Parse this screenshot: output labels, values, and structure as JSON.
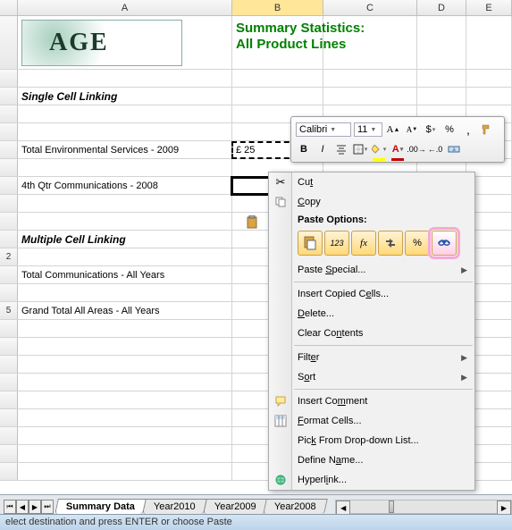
{
  "columns": [
    "A",
    "B",
    "C",
    "D",
    "E"
  ],
  "row_numbers": [
    "",
    "",
    "",
    "",
    "",
    "",
    "",
    "",
    "",
    "",
    "",
    "2",
    "",
    "",
    "5",
    "",
    "",
    "",
    "",
    "",
    "",
    "",
    "",
    "",
    "",
    "",
    ""
  ],
  "title1": "Summary Statistics:",
  "title2": "All Product Lines",
  "logo_text": "AGE",
  "section1": "Single Cell Linking",
  "r6_a": "Total Environmental Services - 2009",
  "r6_b": "£    25",
  "r8_a": "4th Qtr Communications - 2008",
  "section2": "Multiple Cell Linking",
  "r13_a": "Total Communications - All Years",
  "r15_a": "Grand Total All Areas - All Years",
  "mini": {
    "font": "Calibri",
    "size": "11",
    "percent": "%",
    "comma": ","
  },
  "context_menu": {
    "cut": "Cut",
    "copy": "Copy",
    "paste_options": "Paste Options:",
    "paste_special": "Paste Special...",
    "insert_copied": "Insert Copied Cells...",
    "delete": "Delete...",
    "clear": "Clear Contents",
    "filter": "Filter",
    "sort": "Sort",
    "insert_comment": "Insert Comment",
    "format_cells": "Format Cells...",
    "pick_list": "Pick From Drop-down List...",
    "define_name": "Define Name...",
    "hyperlink": "Hyperlink..."
  },
  "tabs": {
    "t1": "Summary Data",
    "t2": "Year2010",
    "t3": "Year2009",
    "t4": "Year2008"
  },
  "status": "elect destination and press ENTER or choose Paste"
}
